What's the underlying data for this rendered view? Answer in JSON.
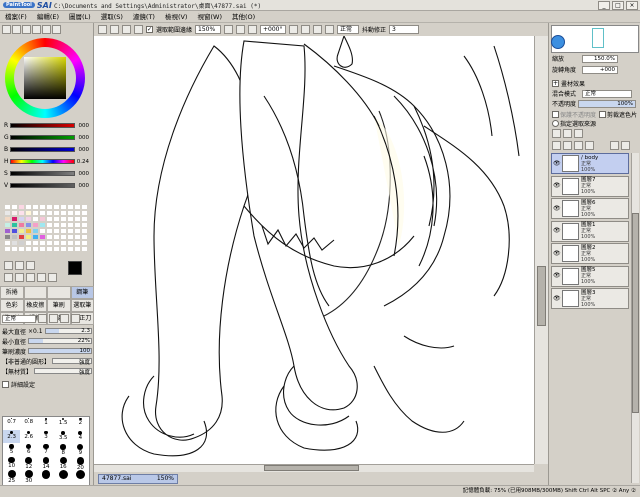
{
  "window": {
    "app_tag": "PaintTool",
    "app_name": "SAI",
    "title": "C:\\Documents and Settings\\Administrator\\桌面\\47877.sai (*)",
    "buttons": [
      "_",
      "□",
      "×"
    ]
  },
  "menu": [
    "檔案(F)",
    "編輯(E)",
    "圖層(L)",
    "選取(S)",
    "濾鏡(T)",
    "檢視(V)",
    "視窗(W)",
    "其他(O)"
  ],
  "toolbar": {
    "select_edges_label": "選取範圍邊緣",
    "zoom": "150%",
    "rotation": "+000°",
    "blend_mode": "正常",
    "stabilizer_label": "抖動修正",
    "stabilizer": "3"
  },
  "color_sliders": [
    {
      "label": "R",
      "value": "000",
      "color": "#d90000"
    },
    {
      "label": "G",
      "value": "000",
      "color": "#00a000"
    },
    {
      "label": "B",
      "value": "000",
      "color": "#0000d0"
    },
    {
      "label": "H",
      "value": "0.24",
      "color": "hue"
    },
    {
      "label": "S",
      "value": "000",
      "color": "#808080"
    },
    {
      "label": "V",
      "value": "000",
      "color": "#606060"
    }
  ],
  "swatch_colors": [
    "#ffffff",
    "#fff",
    "#fbd7e4",
    "#fff",
    "#fff",
    "#fff",
    "#fff",
    "#fff",
    "#fff",
    "#fff",
    "#fff",
    "#fff",
    "#e8e8e8",
    "#f9f0f0",
    "#fce0ec",
    "#fff6d8",
    "#fff",
    "#fff",
    "#fff",
    "#fff",
    "#fff",
    "#fff",
    "#fff",
    "#fff",
    "#f2d9c4",
    "#d71a6a",
    "#d2d2f2",
    "#f4d0e8",
    "#fff",
    "#f5c8d8",
    "#fff",
    "#fff",
    "#fff",
    "#fff",
    "#fff",
    "#fff",
    "#c5f0e6",
    "#2cc3a0",
    "#f07aa0",
    "#8890e8",
    "#f4a0c8",
    "#a0e8f0",
    "#fff",
    "#fff",
    "#fff",
    "#fff",
    "#fff",
    "#fff",
    "#a060d0",
    "#5050e0",
    "#f0f090",
    "#f0c040",
    "#80d0f0",
    "#fff",
    "#fff",
    "#fff",
    "#fff",
    "#fff",
    "#fff",
    "#fff",
    "#888",
    "#c0c0c0",
    "#e04040",
    "#f0f080",
    "#40b0f0",
    "#e060e0",
    "#fff",
    "#fff",
    "#fff",
    "#fff",
    "#fff",
    "#fff",
    "#ffffff",
    "#e0e0e0",
    "#d0d0d0",
    "#fff",
    "#fff",
    "#fff",
    "#fff",
    "#fff",
    "#fff",
    "#fff",
    "#fff",
    "#fff",
    "#fff",
    "#fff",
    "#fff",
    "#fff",
    "#fff",
    "#fff",
    "#fff",
    "#fff",
    "#fff",
    "#fff",
    "#fff",
    "#fff"
  ],
  "brushes": [
    {
      "label": "拆捲"
    },
    {
      "label": ""
    },
    {
      "label": ""
    },
    {
      "label": "鋼筆",
      "selected": true
    },
    {
      "label": "色彩"
    },
    {
      "label": "橡皮擦"
    },
    {
      "label": "筆刷"
    },
    {
      "label": "選取筆"
    },
    {
      "label": "選取擦"
    },
    {
      "label": "粗擦"
    },
    {
      "label": "線條繪"
    },
    {
      "label": "修正刀"
    }
  ],
  "blend_label": "正常",
  "brush_props": [
    {
      "label": "最大直徑",
      "x": "×0.1",
      "value": "2.3",
      "fill": 30
    },
    {
      "label": "最小直徑",
      "value": "22%",
      "fill": 22
    },
    {
      "label": "筆刷濃度",
      "value": "100",
      "fill": 100
    },
    {
      "label": "【非普通的圓形】",
      "value": "強度",
      "fill": 0
    },
    {
      "label": "【無材質】",
      "value": "強度",
      "fill": 0
    }
  ],
  "detail_label": "詳細設定",
  "sizes": [
    "0.7",
    "0.8",
    "1",
    "1.5",
    "2",
    "2.3",
    "2.6",
    "3",
    "3.5",
    "4",
    "5",
    "6",
    "7",
    "8",
    "9",
    "10",
    "12",
    "14",
    "16",
    "20",
    "25",
    "30",
    "",
    "",
    ""
  ],
  "canvas_tab": {
    "name": "47877.sai",
    "zoom": "150%"
  },
  "status": "記憶體負載: 75% (已用908MB/300MB)   Shift Ctrl Alt SPC ② Any ②",
  "navigator": {
    "zoom_label": "縮放",
    "zoom": "150.0%",
    "rotation_label": "旋轉角度",
    "rotation": "+000"
  },
  "layer_panel": {
    "effect_label": "畫材效果",
    "blend_mode_label": "混合模式",
    "blend_mode": "正常",
    "opacity_label": "不透明度",
    "opacity": "100%",
    "preserve_opacity_label": "保護不透明度",
    "clipping_label": "剪裁遮色片",
    "source_label": "指定選取來源"
  },
  "layers": [
    {
      "name": "/ body",
      "mode": "正常",
      "opacity": "100%",
      "selected": true
    },
    {
      "name": "圖層7",
      "mode": "正常",
      "opacity": "100%"
    },
    {
      "name": "圖層6",
      "mode": "正常",
      "opacity": "100%"
    },
    {
      "name": "圖層1",
      "mode": "正常",
      "opacity": "100%"
    },
    {
      "name": "圖層2",
      "mode": "正常",
      "opacity": "100%"
    },
    {
      "name": "圖層5",
      "mode": "正常",
      "opacity": "100%"
    },
    {
      "name": "圖層3",
      "mode": "正常",
      "opacity": "100%"
    }
  ]
}
